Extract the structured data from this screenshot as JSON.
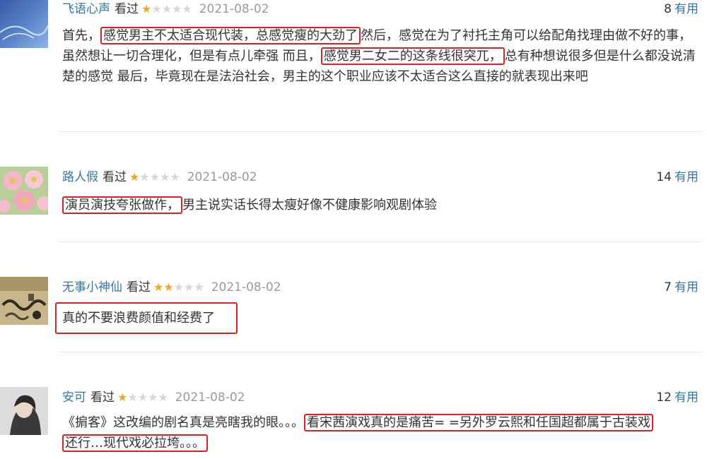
{
  "reviews": [
    {
      "username": "飞语心声",
      "status": "看过",
      "rating": 1,
      "date": "2021-08-02",
      "useful_count": "8",
      "useful_label": "有用",
      "content": {
        "p1": "首先，",
        "h1": "感觉男主不太适合现代装，总感觉瘦的大劲了",
        "p2": "然后，感觉在为了衬托主角可以给配角找理由做不好的事，虽然想让一切合理化，但是有点儿牵强 而且，",
        "h2": "感觉男二女二的这条线很突兀，",
        "p3": "总有种想说很多但是什么都没说清楚的感觉 最后，毕竟现在是法治社会，男主的这个职业应该不太适合这么直接的就表现出来吧"
      }
    },
    {
      "username": "路人假",
      "status": "看过",
      "rating": 1,
      "date": "2021-08-02",
      "useful_count": "14",
      "useful_label": "有用",
      "content": {
        "h1": "演员演技夸张做作，",
        "p1": "男主说实话长得太瘦好像不健康影响观剧体验"
      }
    },
    {
      "username": "无事小神仙",
      "status": "看过",
      "rating": 2,
      "date": "2021-08-02",
      "useful_count": "7",
      "useful_label": "有用",
      "content": {
        "h1": "真的不要浪费颜值和经费了"
      }
    },
    {
      "username": "安可",
      "status": "看过",
      "rating": 1,
      "date": "2021-08-02",
      "useful_count": "12",
      "useful_label": "有用",
      "content": {
        "p1": "《掮客》这改编的剧名真是亮瞎我的眼。。。",
        "h1": "看宋茜演戏真的是痛苦= =另外罗云熙和任国超都属于古装戏",
        "h2": "还行…现代戏必拉垮。。。"
      }
    }
  ],
  "colors": {
    "link": "#3377aa",
    "star_on": "#f5a623",
    "star_off": "#d6d6d6",
    "highlight_box": "#e02020",
    "date": "#9a9a9a"
  },
  "icons": {
    "star": "star-icon"
  }
}
